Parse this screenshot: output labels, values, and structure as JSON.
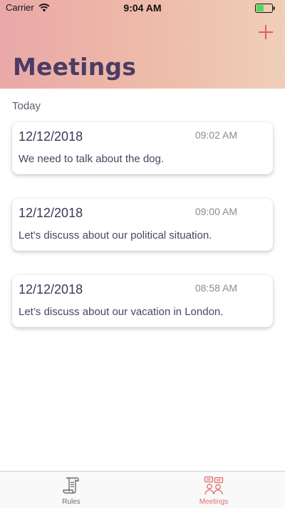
{
  "status_bar": {
    "carrier": "Carrier",
    "time": "9:04 AM",
    "wifi_icon": "wifi-icon",
    "battery_icon": "battery-icon",
    "battery_color": "#4cd964"
  },
  "header": {
    "title": "Meetings",
    "add_icon": "plus-icon",
    "title_color": "#4b3c63",
    "add_color": "#e05d5d"
  },
  "section": {
    "label": "Today"
  },
  "meetings": [
    {
      "date": "12/12/2018",
      "time": "09:02 AM",
      "text": "We need to talk about the dog."
    },
    {
      "date": "12/12/2018",
      "time": "09:00 AM",
      "text": "Let's discuss about our political situation."
    },
    {
      "date": "12/12/2018",
      "time": "08:58 AM",
      "text": "Let’s discuss about our vacation in London."
    }
  ],
  "tab_bar": {
    "tabs": [
      {
        "label": "Rules",
        "icon": "scroll-icon",
        "selected": false
      },
      {
        "label": "Meetings",
        "icon": "meeting-chat-icon",
        "selected": true
      }
    ],
    "active_color": "#e16d6d",
    "inactive_color": "#6e6e73"
  }
}
